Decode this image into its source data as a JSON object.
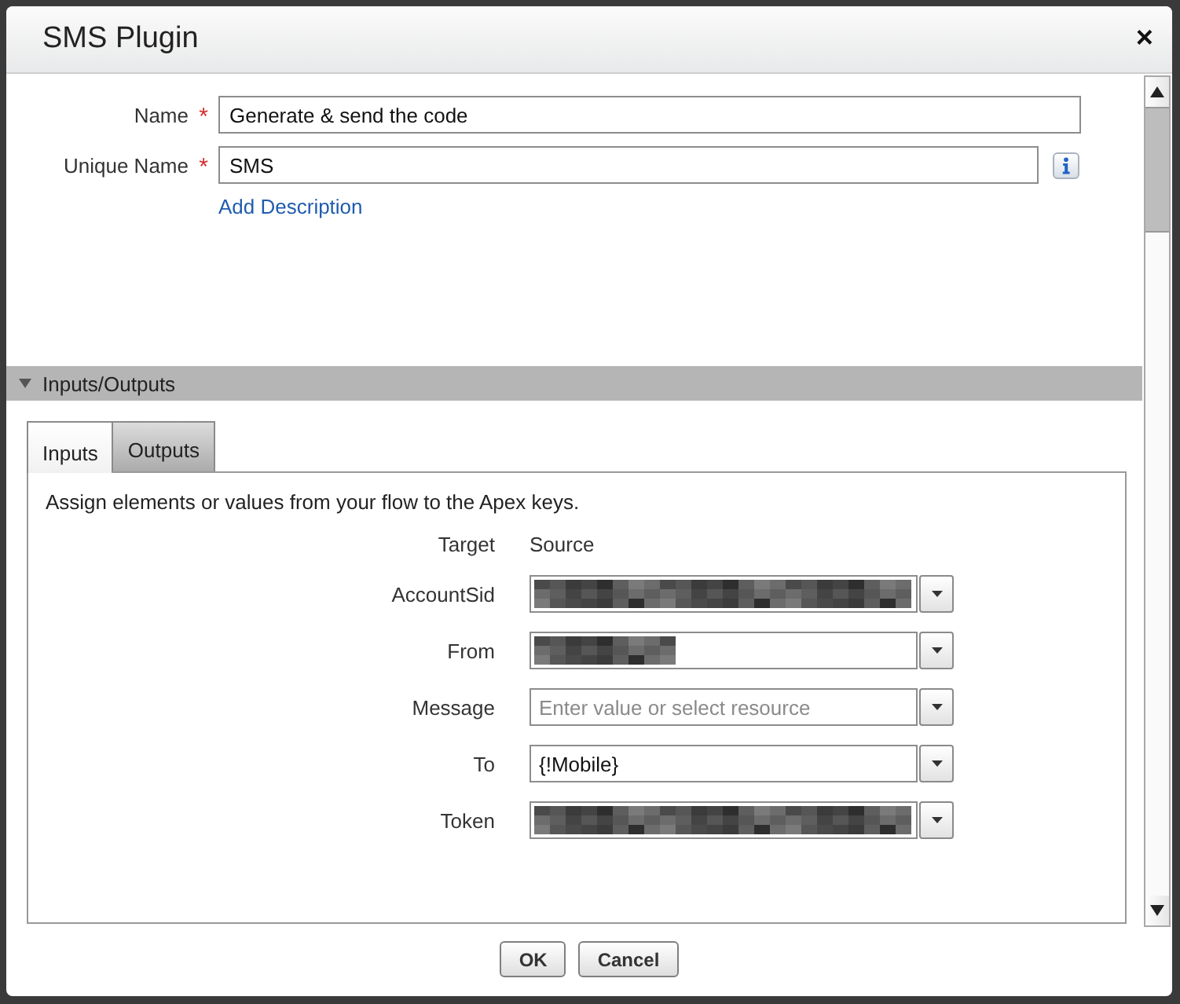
{
  "window": {
    "title": "SMS Plugin",
    "close": "×"
  },
  "fields": [
    {
      "label": "Name",
      "required_mark": "*",
      "value": "Generate & send the code",
      "info": false
    },
    {
      "label": "Unique Name",
      "required_mark": "*",
      "value": "SMS",
      "info": true
    }
  ],
  "add_description_link": "Add Description",
  "section": {
    "title": "Inputs/Outputs",
    "expanded": true
  },
  "tabs": [
    {
      "label": "Inputs",
      "selected": true
    },
    {
      "label": "Outputs",
      "selected": false
    }
  ],
  "panel": {
    "description": "Assign elements or values from your flow to the Apex keys.",
    "columns": [
      "Target",
      "Source"
    ],
    "rows": [
      {
        "target": "AccountSid",
        "source": {
          "kind": "redacted"
        }
      },
      {
        "target": "From",
        "source": {
          "kind": "redacted-short"
        }
      },
      {
        "target": "Message",
        "source": {
          "kind": "text",
          "placeholder": "Enter value or select resource"
        }
      },
      {
        "target": "To",
        "source": {
          "kind": "text",
          "value": "{!Mobile}"
        }
      },
      {
        "target": "Token",
        "source": {
          "kind": "redacted"
        }
      }
    ]
  },
  "buttons": [
    "OK",
    "Cancel"
  ]
}
